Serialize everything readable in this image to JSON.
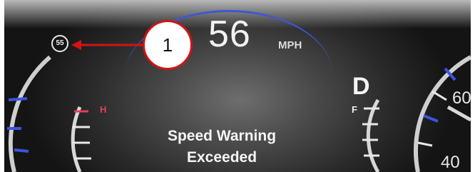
{
  "cluster": {
    "speed_value": "56",
    "speed_unit": "MPH",
    "speed_limit": "55",
    "callout_number": "1",
    "warning_line1": "Speed Warning",
    "warning_line2": "Exceeded",
    "gear": "D",
    "temp_high_label": "H",
    "fuel_full_label": "F",
    "tach_top": "60",
    "tach_bottom": "40"
  },
  "colors": {
    "accent_blue": "#3e56d8",
    "callout_red": "#d11414",
    "warning_text": "#f5f5f5",
    "temp_red": "#e0405a"
  }
}
